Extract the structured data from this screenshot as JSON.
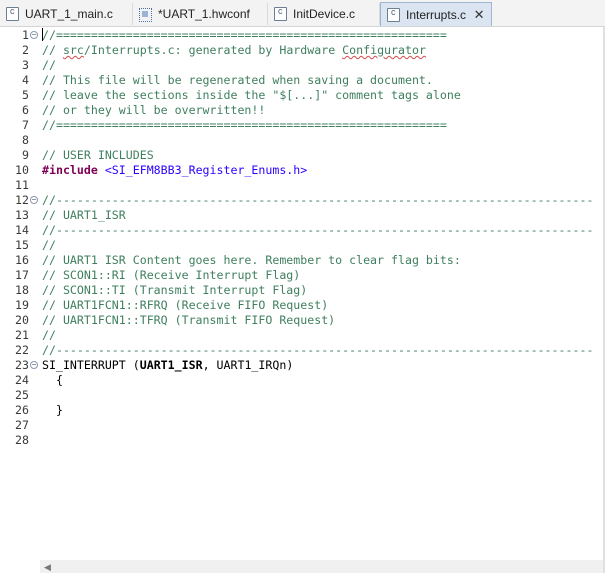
{
  "tabs": [
    {
      "label": "UART_1_main.c",
      "icon": "c-file-icon",
      "active": false
    },
    {
      "label": "*UART_1.hwconf",
      "icon": "hwconf-icon",
      "active": false
    },
    {
      "label": "InitDevice.c",
      "icon": "c-file-icon",
      "active": false
    },
    {
      "label": "Interrupts.c",
      "icon": "c-file-icon",
      "active": true
    }
  ],
  "close_glyph": "✕",
  "editor": {
    "lines": [
      {
        "n": "1",
        "fold": "−",
        "text": "//========================================================",
        "style": "cm"
      },
      {
        "n": "2",
        "text": "// src/Interrupts.c: generated by Hardware Configurator",
        "style": "cm"
      },
      {
        "n": "3",
        "text": "//",
        "style": "cm"
      },
      {
        "n": "4",
        "text": "// This file will be regenerated when saving a document.",
        "style": "cm"
      },
      {
        "n": "5",
        "text": "// leave the sections inside the \"$[...]\" comment tags alone",
        "style": "cm"
      },
      {
        "n": "6",
        "text": "// or they will be overwritten!!",
        "style": "cm"
      },
      {
        "n": "7",
        "text": "//========================================================",
        "style": "cm"
      },
      {
        "n": "8",
        "text": "",
        "style": "pl"
      },
      {
        "n": "9",
        "text": "// USER INCLUDES",
        "style": "cm"
      },
      {
        "n": "10",
        "text": "#include <SI_EFM8BB3_Register_Enums.h>",
        "style": "inc"
      },
      {
        "n": "11",
        "text": "",
        "style": "pl"
      },
      {
        "n": "12",
        "fold": "−",
        "text": "//-----------------------------------------------------------------------------",
        "style": "cm"
      },
      {
        "n": "13",
        "text": "// UART1_ISR",
        "style": "cm"
      },
      {
        "n": "14",
        "text": "//-----------------------------------------------------------------------------",
        "style": "cm"
      },
      {
        "n": "15",
        "text": "//",
        "style": "cm"
      },
      {
        "n": "16",
        "text": "// UART1 ISR Content goes here. Remember to clear flag bits:",
        "style": "cm"
      },
      {
        "n": "17",
        "text": "// SCON1::RI (Receive Interrupt Flag)",
        "style": "cm"
      },
      {
        "n": "18",
        "text": "// SCON1::TI (Transmit Interrupt Flag)",
        "style": "cm"
      },
      {
        "n": "19",
        "text": "// UART1FCN1::RFRQ (Receive FIFO Request)",
        "style": "cm"
      },
      {
        "n": "20",
        "text": "// UART1FCN1::TFRQ (Transmit FIFO Request)",
        "style": "cm"
      },
      {
        "n": "21",
        "text": "//",
        "style": "cm"
      },
      {
        "n": "22",
        "text": "//-----------------------------------------------------------------------------",
        "style": "cm"
      },
      {
        "n": "23",
        "fold": "−",
        "text": "SI_INTERRUPT (UART1_ISR, UART1_IRQn)",
        "style": "isr"
      },
      {
        "n": "24",
        "text": "  {",
        "style": "pl"
      },
      {
        "n": "25",
        "text": "",
        "style": "pl"
      },
      {
        "n": "26",
        "text": "  }",
        "style": "pl"
      },
      {
        "n": "27",
        "text": "",
        "style": "pl"
      },
      {
        "n": "28",
        "text": "",
        "style": "pl"
      }
    ]
  },
  "scroll_left_glyph": "◀"
}
